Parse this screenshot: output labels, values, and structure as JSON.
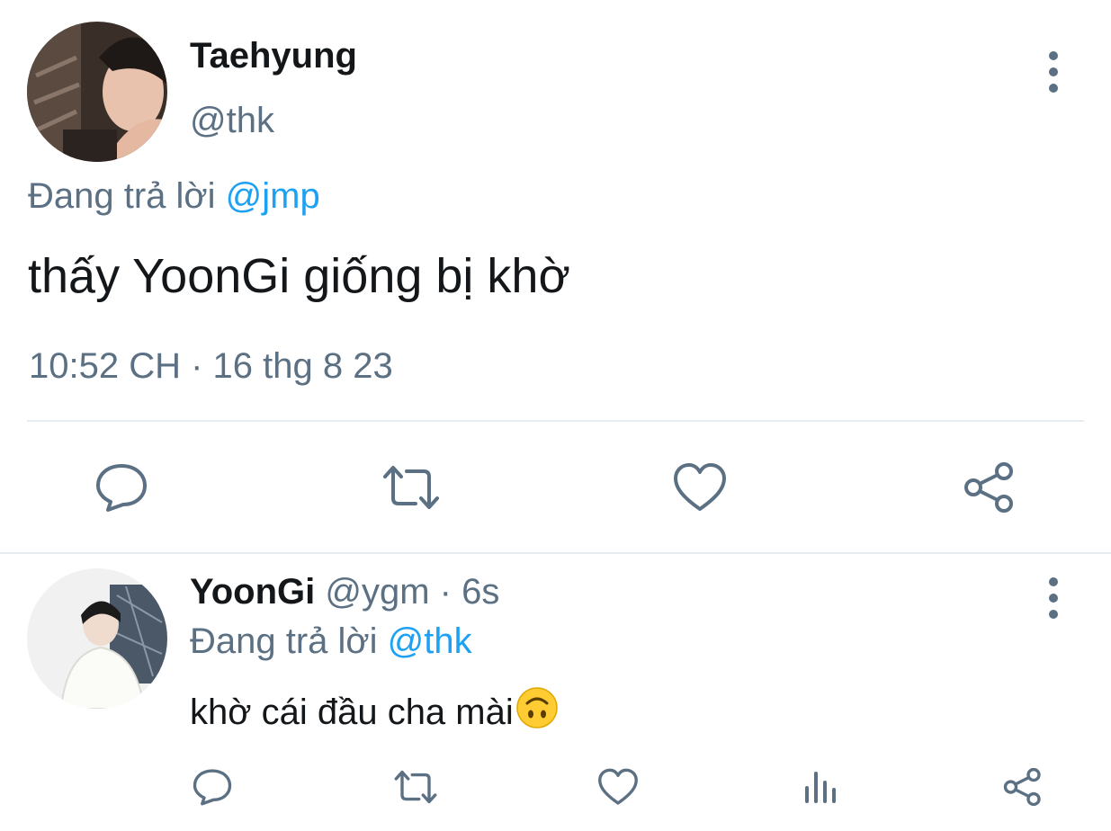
{
  "main_tweet": {
    "display_name": "Taehyung",
    "handle": "@thk",
    "reply_prefix": "Đang trả lời",
    "reply_to": "@jmp",
    "text": "thấy YoonGi giống bị khờ",
    "timestamp": "10:52 CH · 16 thg 8 23",
    "actions": [
      "reply-icon",
      "retweet-icon",
      "like-icon",
      "share-icon"
    ]
  },
  "reply_tweet": {
    "display_name": "YoonGi",
    "meta": "@ygm · 6s",
    "reply_prefix": "Đang trả lời",
    "reply_to": "@thk",
    "text": "khờ cái đầu cha mài",
    "emoji": "upside-down-face-emoji",
    "actions": [
      "reply-icon",
      "retweet-icon",
      "like-icon",
      "analytics-icon",
      "share-icon"
    ]
  },
  "colors": {
    "text": "#14171a",
    "muted": "#5b7083",
    "link": "#1da1f2",
    "divider": "#e6ecf0"
  }
}
